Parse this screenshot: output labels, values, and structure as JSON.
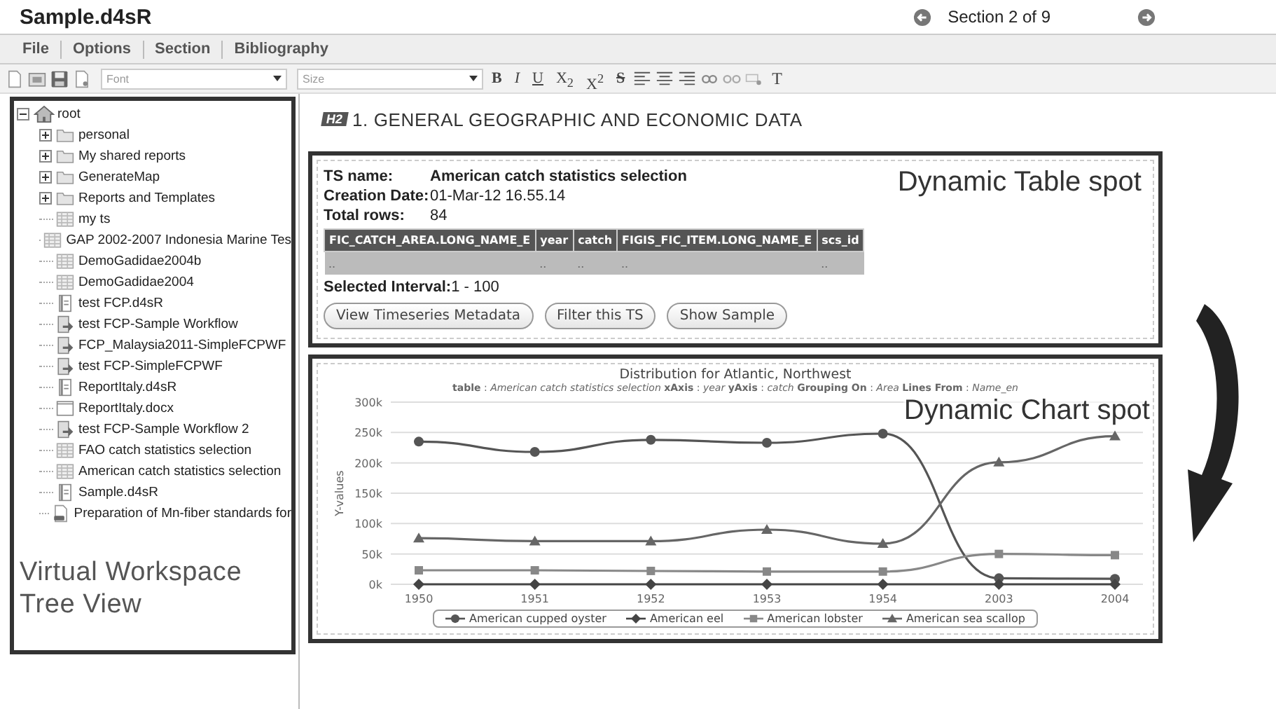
{
  "window": {
    "title": "Sample.d4sR"
  },
  "navigation": {
    "label": "Section 2 of 9"
  },
  "menu": [
    {
      "label": "File"
    },
    {
      "label": "Options"
    },
    {
      "label": "Section"
    },
    {
      "label": "Bibliography"
    }
  ],
  "toolbar": {
    "font_select": {
      "placeholder": "Font"
    },
    "size_select": {
      "placeholder": "Size"
    },
    "format_buttons": [
      {
        "kind": "bold",
        "label": "B"
      },
      {
        "kind": "italic",
        "label": "I"
      },
      {
        "kind": "underline",
        "label": "U"
      },
      {
        "kind": "script",
        "label": "X$_{2}$"
      },
      {
        "kind": "script",
        "label": "X$^{2}$"
      },
      {
        "kind": "strike",
        "label": "S"
      }
    ],
    "clear_format": {
      "label": "T"
    }
  },
  "tree": {
    "label": "root",
    "expanded": true,
    "children": [
      {
        "kind": "folder",
        "label": "personal",
        "expanded": false
      },
      {
        "kind": "folder",
        "label": "My shared reports",
        "expanded": false
      },
      {
        "kind": "folder",
        "label": "GenerateMap",
        "expanded": false
      },
      {
        "kind": "folder",
        "label": "Reports and Templates",
        "expanded": false
      },
      {
        "kind": "table",
        "label": "my ts"
      },
      {
        "kind": "table",
        "label": "GAP 2002-2007 Indonesia Marine Tes"
      },
      {
        "kind": "table",
        "label": "DemoGadidae2004b"
      },
      {
        "kind": "table",
        "label": "DemoGadidae2004"
      },
      {
        "kind": "report",
        "label": "test FCP.d4sR"
      },
      {
        "kind": "workflow",
        "label": "test FCP-Sample Workflow"
      },
      {
        "kind": "workflow",
        "label": "FCP_Malaysia2011-SimpleFCPWF"
      },
      {
        "kind": "workflow",
        "label": "test FCP-SimpleFCPWF"
      },
      {
        "kind": "report",
        "label": "ReportItaly.d4sR"
      },
      {
        "kind": "document",
        "label": "ReportItaly.docx"
      },
      {
        "kind": "workflow",
        "label": "test FCP-Sample Workflow 2"
      },
      {
        "kind": "table",
        "label": "FAO catch statistics selection"
      },
      {
        "kind": "table",
        "label": "American catch statistics selection"
      },
      {
        "kind": "report",
        "label": "Sample.d4sR"
      },
      {
        "kind": "file",
        "label": "Preparation of Mn-fiber standards for"
      }
    ]
  },
  "tree_caption": "Virtual Workspace Tree View",
  "section_heading": {
    "badge": "H2",
    "title": "1. GENERAL GEOGRAPHIC AND ECONOMIC DATA"
  },
  "table_spot": {
    "caption": "Dynamic Table spot",
    "fields": [
      {
        "label": "TS name:",
        "value": "American catch statistics selection",
        "bold_value": true
      },
      {
        "label": "Creation Date:",
        "value": "01-Mar-12 16.55.14",
        "bold_value": false
      },
      {
        "label": "Total rows:",
        "value": "84",
        "bold_value": false
      }
    ],
    "columns": [
      "FIC_CATCH_AREA.LONG_NAME_E",
      "year",
      "catch",
      "FIGIS_FIC_ITEM.LONG_NAME_E",
      "scs_id"
    ],
    "rows": [
      [
        "..",
        "..",
        "..",
        "..",
        ".."
      ]
    ],
    "interval": {
      "label": "Selected Interval:",
      "value": "1 - 100"
    },
    "buttons": [
      "View Timeseries Metadata",
      "Filter this TS",
      "Show Sample"
    ]
  },
  "chart_spot": {
    "caption": "Dynamic Chart spot",
    "subtitle": "**table** : *American catch statistics selection* **xAxis** : *year* **yAxis** : *catch* **Grouping On** : *Area* **Lines From** : *Name_en*",
    "chart_data": {
      "type": "line",
      "title": "Distribution for Atlantic, Northwest",
      "ylabel": "Y-values",
      "categories": [
        "1950",
        "1951",
        "1952",
        "1953",
        "1954",
        "2003",
        "2004"
      ],
      "ylim": [
        0,
        300000
      ],
      "grid": true,
      "legend": "bottom",
      "yticks": [
        {
          "value": 0,
          "label": "0k"
        },
        {
          "value": 50000,
          "label": "50k"
        },
        {
          "value": 100000,
          "label": "100k"
        },
        {
          "value": 150000,
          "label": "150k"
        },
        {
          "value": 200000,
          "label": "200k"
        },
        {
          "value": 250000,
          "label": "250k"
        },
        {
          "value": 300000,
          "label": "300k"
        }
      ],
      "series": [
        {
          "name": "American cupped oyster",
          "color": "#555555",
          "marker": "circle",
          "values": [
            235000,
            218000,
            238000,
            233000,
            248000,
            10000,
            9000
          ]
        },
        {
          "name": "American eel",
          "color": "#444444",
          "marker": "diamond",
          "values": [
            0,
            0,
            0,
            0,
            0,
            0,
            0
          ]
        },
        {
          "name": "American lobster",
          "color": "#888888",
          "marker": "square",
          "values": [
            23000,
            23000,
            22000,
            21000,
            21000,
            50000,
            48000
          ]
        },
        {
          "name": "American sea scallop",
          "color": "#666666",
          "marker": "triangle",
          "values": [
            76000,
            71000,
            71000,
            90000,
            67000,
            201000,
            244000
          ]
        }
      ]
    }
  }
}
